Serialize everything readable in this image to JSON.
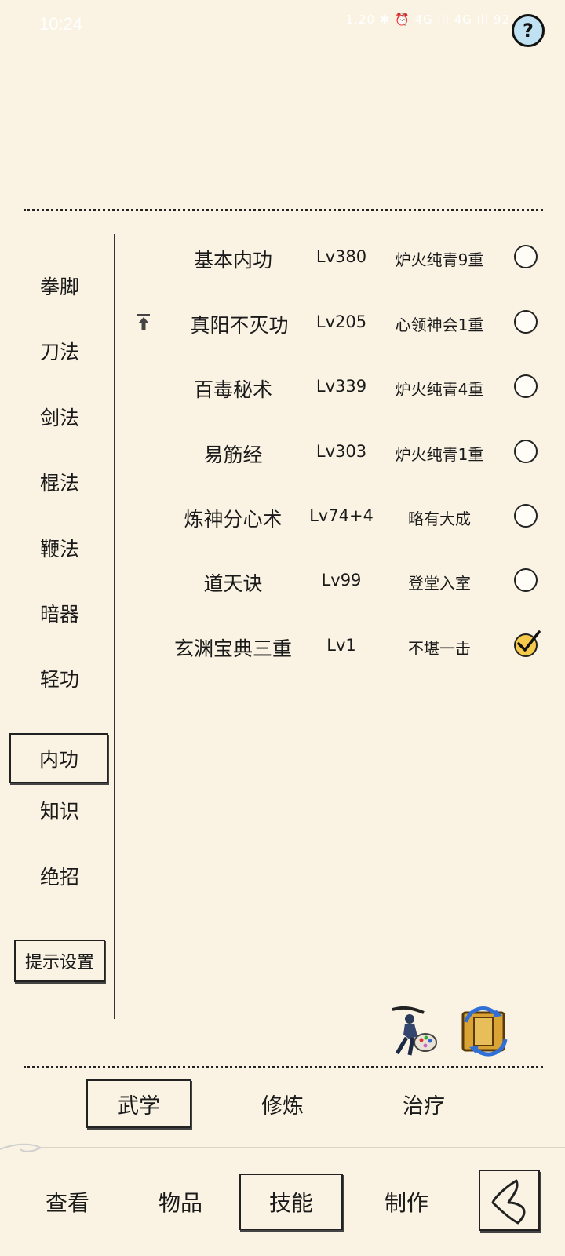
{
  "status_bar": {
    "time": "10:24",
    "icons_text": "1.20 ✱ ⏰ 4G ıll 4G ıll 92"
  },
  "help_button": {
    "label": "?"
  },
  "categories": [
    {
      "label": "拳脚",
      "active": false
    },
    {
      "label": "刀法",
      "active": false
    },
    {
      "label": "剑法",
      "active": false
    },
    {
      "label": "棍法",
      "active": false
    },
    {
      "label": "鞭法",
      "active": false
    },
    {
      "label": "暗器",
      "active": false
    },
    {
      "label": "轻功",
      "active": false
    },
    {
      "label": "内功",
      "active": true
    },
    {
      "label": "知识",
      "active": false
    },
    {
      "label": "绝招",
      "active": false
    }
  ],
  "hint_settings_label": "提示设置",
  "skills": [
    {
      "name": "基本内功",
      "level": "Lv380",
      "realm": "炉火纯青9重",
      "checked": false,
      "upgrade": false
    },
    {
      "name": "真阳不灭功",
      "level": "Lv205",
      "realm": "心领神会1重",
      "checked": false,
      "upgrade": true
    },
    {
      "name": "百毒秘术",
      "level": "Lv339",
      "realm": "炉火纯青4重",
      "checked": false,
      "upgrade": false
    },
    {
      "name": "易筋经",
      "level": "Lv303",
      "realm": "炉火纯青1重",
      "checked": false,
      "upgrade": false
    },
    {
      "name": "炼神分心术",
      "level": "Lv74+4",
      "realm": "略有大成",
      "checked": false,
      "upgrade": false
    },
    {
      "name": "道天诀",
      "level": "Lv99",
      "realm": "登堂入室",
      "checked": false,
      "upgrade": false
    },
    {
      "name": "玄渊宝典三重",
      "level": "Lv1",
      "realm": "不堪一击",
      "checked": true,
      "upgrade": false
    }
  ],
  "sub_tabs": [
    {
      "label": "武学",
      "active": true
    },
    {
      "label": "修炼",
      "active": false
    },
    {
      "label": "治疗",
      "active": false
    }
  ],
  "nav_tabs": [
    {
      "label": "查看",
      "active": false
    },
    {
      "label": "物品",
      "active": false
    },
    {
      "label": "技能",
      "active": true
    },
    {
      "label": "制作",
      "active": false
    }
  ],
  "icons": {
    "martial-art-skin": "warrior-palette-icon",
    "skill-switch": "book-swap-icon",
    "back": "back-arrow-icon"
  },
  "colors": {
    "background": "#faf3e3",
    "ink": "#1a1a1a",
    "checked_fill": "#f7c94a",
    "help_fill": "#bfe1f2"
  }
}
